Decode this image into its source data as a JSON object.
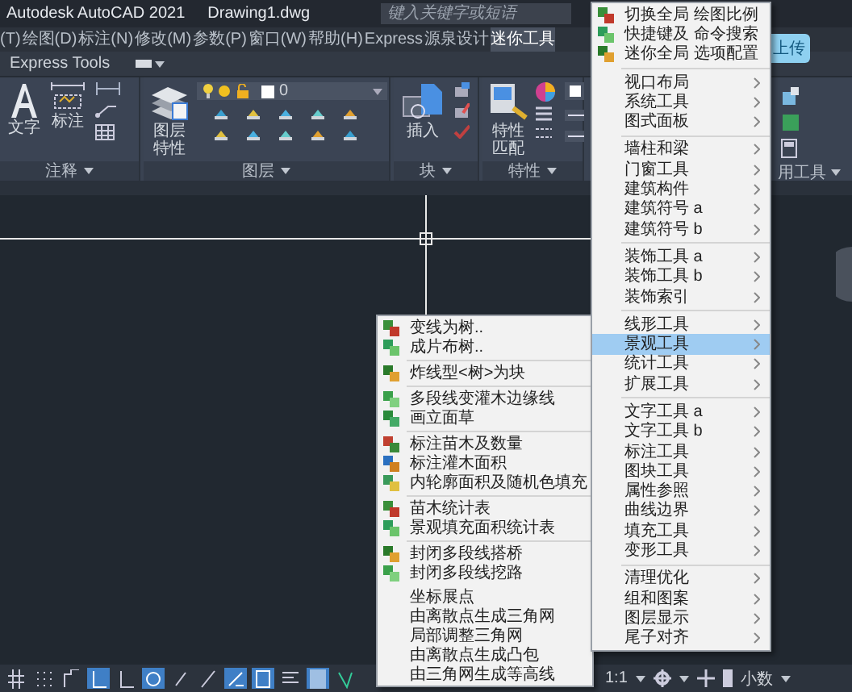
{
  "title_bar": {
    "app": "Autodesk AutoCAD 2021",
    "document": "Drawing1.dwg",
    "search": {
      "placeholder": "键入关键字或短语"
    }
  },
  "menu_bar": {
    "items": [
      {
        "label": "(T)",
        "selected": false
      },
      {
        "label": "绘图(D)",
        "selected": false
      },
      {
        "label": "标注(N)",
        "selected": false
      },
      {
        "label": "修改(M)",
        "selected": false
      },
      {
        "label": "参数(P)",
        "selected": false
      },
      {
        "label": "窗口(W)",
        "selected": false
      },
      {
        "label": "帮助(H)",
        "selected": false
      },
      {
        "label": "Express",
        "selected": false
      },
      {
        "label": "源泉设计",
        "selected": false
      },
      {
        "label": "迷你工具",
        "selected": true
      }
    ]
  },
  "ribbon_tab": {
    "label": "Express Tools"
  },
  "ribbon": {
    "panels": [
      {
        "title": "注释",
        "tools": [
          {
            "label": "文字"
          },
          {
            "label": "标注"
          }
        ]
      },
      {
        "title": "图层",
        "tools": [
          {
            "label": "图层特性"
          }
        ],
        "layer_value": "0"
      },
      {
        "title": "块",
        "tools": [
          {
            "label": "插入"
          }
        ]
      },
      {
        "title": "特性",
        "tools": [
          {
            "label": "特性匹配"
          }
        ]
      }
    ],
    "upload_button": {
      "label": "上传"
    },
    "partial_panel_title": "用工具"
  },
  "main_menu": {
    "groups": [
      [
        {
          "kind": "command",
          "label": "切换全局 绘图比例",
          "selected": false
        },
        {
          "kind": "command",
          "label": "快捷键及 命令搜索",
          "selected": false
        },
        {
          "kind": "command",
          "label": "迷你全局 选项配置",
          "selected": false
        }
      ],
      [
        {
          "kind": "submenu",
          "label": "视口布局",
          "selected": false
        },
        {
          "kind": "submenu",
          "label": "系统工具",
          "selected": false
        },
        {
          "kind": "submenu",
          "label": "图式面板",
          "selected": false
        }
      ],
      [
        {
          "kind": "submenu",
          "label": "墙柱和梁",
          "selected": false
        },
        {
          "kind": "submenu",
          "label": "门窗工具",
          "selected": false
        },
        {
          "kind": "submenu",
          "label": "建筑构件",
          "selected": false
        },
        {
          "kind": "submenu",
          "label": "建筑符号 a",
          "selected": false
        },
        {
          "kind": "submenu",
          "label": "建筑符号 b",
          "selected": false
        }
      ],
      [
        {
          "kind": "submenu",
          "label": "装饰工具 a",
          "selected": false
        },
        {
          "kind": "submenu",
          "label": "装饰工具 b",
          "selected": false
        },
        {
          "kind": "submenu",
          "label": "装饰索引",
          "selected": false
        }
      ],
      [
        {
          "kind": "submenu",
          "label": "线形工具",
          "selected": false
        },
        {
          "kind": "submenu",
          "label": "景观工具",
          "selected": true
        },
        {
          "kind": "submenu",
          "label": "统计工具",
          "selected": false
        },
        {
          "kind": "submenu",
          "label": "扩展工具",
          "selected": false
        }
      ],
      [
        {
          "kind": "submenu",
          "label": "文字工具 a",
          "selected": false
        },
        {
          "kind": "submenu",
          "label": "文字工具 b",
          "selected": false
        },
        {
          "kind": "submenu",
          "label": "标注工具",
          "selected": false
        },
        {
          "kind": "submenu",
          "label": "图块工具",
          "selected": false
        },
        {
          "kind": "submenu",
          "label": "属性参照",
          "selected": false
        },
        {
          "kind": "submenu",
          "label": "曲线边界",
          "selected": false
        },
        {
          "kind": "submenu",
          "label": "填充工具",
          "selected": false
        },
        {
          "kind": "submenu",
          "label": "变形工具",
          "selected": false
        }
      ],
      [
        {
          "kind": "submenu",
          "label": "清理优化",
          "selected": false
        },
        {
          "kind": "submenu",
          "label": "组和图案",
          "selected": false
        },
        {
          "kind": "submenu",
          "label": "图层显示",
          "selected": false
        },
        {
          "kind": "submenu",
          "label": "尾子对齐",
          "selected": false
        }
      ]
    ]
  },
  "submenu": {
    "groups": [
      [
        {
          "kind": "command",
          "label": "变线为树..",
          "selected": false
        },
        {
          "kind": "command",
          "label": "成片布树..",
          "selected": false
        }
      ],
      [
        {
          "kind": "command",
          "label": "炸线型<树>为块",
          "selected": false
        }
      ],
      [
        {
          "kind": "command",
          "label": "多段线变灌木边缘线",
          "selected": false
        },
        {
          "kind": "command",
          "label": "画立面草",
          "selected": false
        }
      ],
      [
        {
          "kind": "command",
          "label": "标注苗木及数量",
          "selected": false
        },
        {
          "kind": "command",
          "label": "标注灌木面积",
          "selected": false
        },
        {
          "kind": "command",
          "label": "内轮廓面积及随机色填充",
          "selected": false
        }
      ],
      [
        {
          "kind": "command",
          "label": "苗木统计表",
          "selected": false
        },
        {
          "kind": "command",
          "label": "景观填充面积统计表",
          "selected": false
        }
      ],
      [
        {
          "kind": "command",
          "label": "封闭多段线搭桥",
          "selected": false
        },
        {
          "kind": "command",
          "label": "封闭多段线挖路",
          "selected": false
        }
      ],
      [
        {
          "kind": "plain",
          "label": "坐标展点",
          "selected": false
        },
        {
          "kind": "plain",
          "label": "由离散点生成三角网",
          "selected": false
        },
        {
          "kind": "plain",
          "label": "局部调整三角网",
          "selected": false
        },
        {
          "kind": "plain",
          "label": "由离散点生成凸包",
          "selected": false
        },
        {
          "kind": "plain",
          "label": "由三角网生成等高线",
          "selected": false
        }
      ]
    ]
  },
  "status_bar": {
    "toggles": [
      {
        "on": false
      },
      {
        "on": false
      },
      {
        "on": false
      },
      {
        "on": true
      },
      {
        "on": false
      },
      {
        "on": true
      },
      {
        "on": false
      },
      {
        "on": false
      },
      {
        "on": true
      },
      {
        "on": true
      },
      {
        "on": false
      },
      {
        "on": true
      },
      {
        "on": false
      }
    ],
    "scale": "1:1",
    "units": "小数"
  }
}
